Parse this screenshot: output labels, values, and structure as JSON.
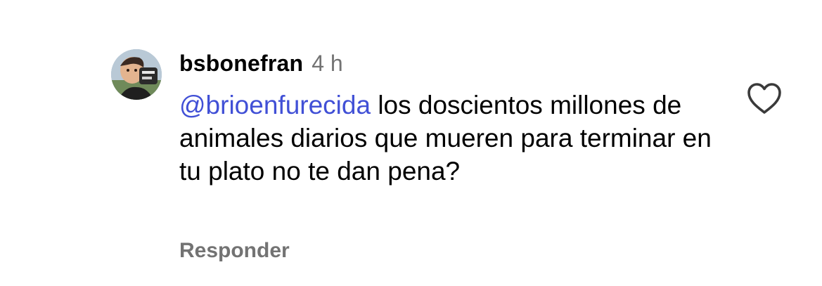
{
  "comment": {
    "username": "bsbonefran",
    "timestamp": "4 h",
    "mention": "@brioenfurecida",
    "text": " los doscientos millones de animales diarios que mueren para terminar en tu plato no te dan pena?",
    "reply_label": "Responder",
    "like_icon": "heart-outline-icon"
  },
  "colors": {
    "mention": "#4150d6",
    "secondary_text": "#737373",
    "icon_stroke": "#3a3a3a"
  }
}
